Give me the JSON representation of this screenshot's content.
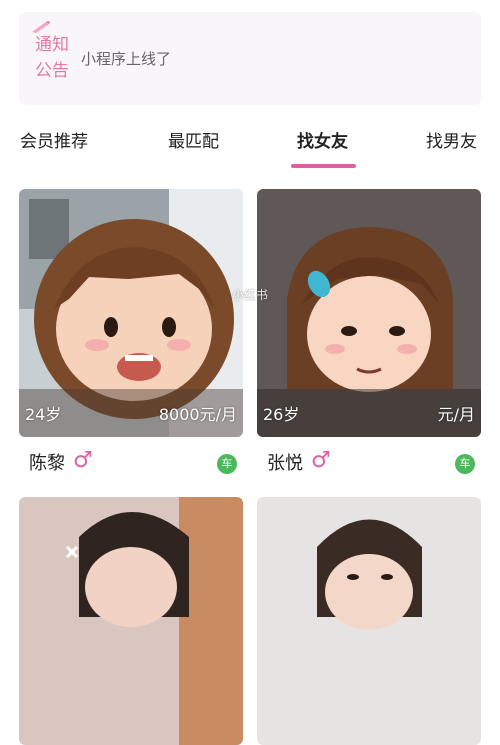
{
  "notice": {
    "label": "通知公告",
    "text": "小程序上线了"
  },
  "tabs": [
    {
      "label": "会员推荐"
    },
    {
      "label": "最匹配"
    },
    {
      "label": "找女友",
      "active": true
    },
    {
      "label": "找男友"
    }
  ],
  "cards": [
    {
      "age": "24岁",
      "income": "8000元/月",
      "name": "陈黎",
      "gender_symbol": "♂",
      "badge": "车"
    },
    {
      "age": "26岁",
      "income": "元/月",
      "name": "张悦",
      "gender_symbol": "♂",
      "badge": "车"
    },
    {},
    {}
  ],
  "watermark": "小红书",
  "colors": {
    "accent": "#e05fa0",
    "notice_label": "#e27aa7",
    "car_badge": "#4cb85c",
    "notice_bg": "#f8f6f9"
  },
  "icons": [
    "pen-icon",
    "male-symbol-icon",
    "car-badge-icon"
  ]
}
